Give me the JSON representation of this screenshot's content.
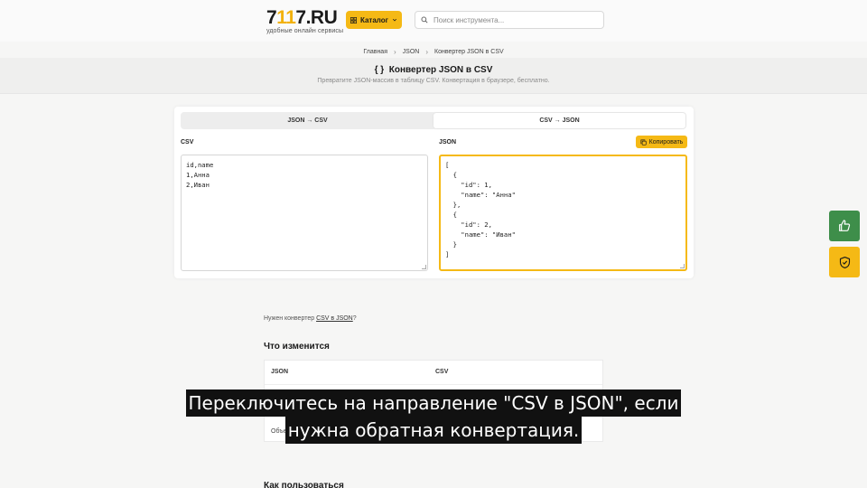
{
  "header": {
    "logo_prefix": "7",
    "logo_accent": "11",
    "logo_suffix": "7.RU",
    "logo_tagline": "удобные онлайн сервисы",
    "catalog_label": "Каталог",
    "search_placeholder": "Поиск инструмента..."
  },
  "breadcrumb": [
    "Главная",
    "JSON",
    "Конвертер JSON в CSV"
  ],
  "hero": {
    "icon": "{ }",
    "title": "Конвертер JSON в CSV",
    "subtitle": "Превратите JSON-массив в таблицу CSV. Конвертация в браузере, бесплатно."
  },
  "converter": {
    "tabs": [
      {
        "label": "JSON → CSV",
        "active": false
      },
      {
        "label": "CSV → JSON",
        "active": true
      }
    ],
    "csv_label": "CSV",
    "json_label": "JSON",
    "copy_label": "Копировать",
    "csv_value": "id,name\n1,Анна\n2,Иван",
    "json_value": "[\n  {\n    \"id\": 1,\n    \"name\": \"Анна\"\n  },\n  {\n    \"id\": 2,\n    \"name\": \"Иван\"\n  }\n]"
  },
  "content": {
    "hint_prefix": "Нужен конвертер ",
    "hint_link": "CSV в JSON",
    "hint_suffix": "?",
    "changes_title": "Что изменится",
    "table_headers": [
      "JSON",
      "CSV"
    ],
    "table_row_label": "Объект",
    "how_to_title": "Как пользоваться"
  },
  "caption": {
    "line1": "Переключитесь на направление \"CSV в JSON\", если",
    "line2": "нужна обратная конвертация."
  },
  "colors": {
    "accent": "#f5b915",
    "like_green": "#3e8e4a"
  }
}
